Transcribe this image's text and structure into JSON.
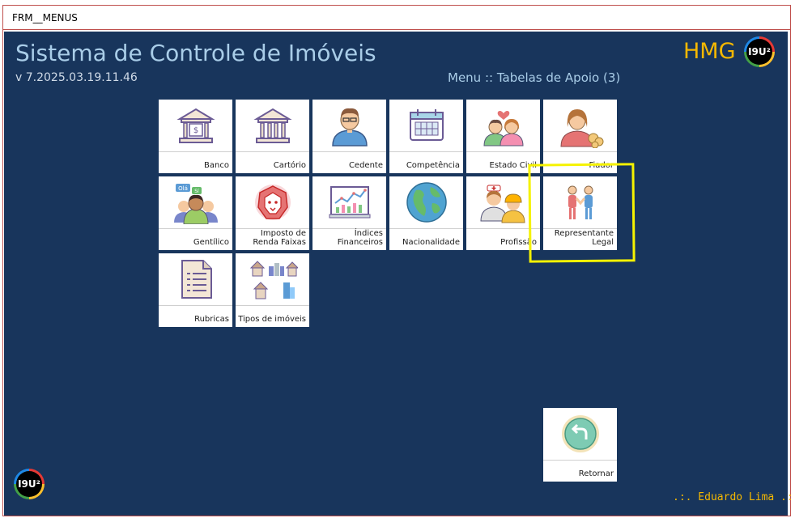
{
  "window": {
    "title": "FRM__MENUS"
  },
  "header": {
    "app_title": "Sistema de Controle de Imóveis",
    "version": "v 7.2025.03.19.11.46",
    "menu_caption": "Menu :: Tabelas de Apoio (3)",
    "brand": "HMG",
    "logo_text": "I9U²"
  },
  "tiles": [
    {
      "label": "Banco",
      "icon": "bank-icon"
    },
    {
      "label": "Cartório",
      "icon": "building-icon"
    },
    {
      "label": "Cedente",
      "icon": "person-icon"
    },
    {
      "label": "Competência",
      "icon": "calendar-icon"
    },
    {
      "label": "Estado Civil",
      "icon": "couple-icon"
    },
    {
      "label": "Fiador",
      "icon": "guarantor-icon"
    },
    {
      "label": "Gentílico",
      "icon": "people-chat-icon"
    },
    {
      "label": "Imposto de Renda Faixas",
      "icon": "lion-icon"
    },
    {
      "label": "Índices Financeiros",
      "icon": "financial-chart-icon"
    },
    {
      "label": "Nacionalidade",
      "icon": "globe-icon"
    },
    {
      "label": "Profissão",
      "icon": "workers-icon"
    },
    {
      "label": "Representante Legal",
      "icon": "handshake-icon"
    },
    {
      "label": "Rubricas",
      "icon": "document-icon"
    },
    {
      "label": "Tipos de imóveis",
      "icon": "buildings-icon"
    }
  ],
  "return_button": {
    "label": "Retornar",
    "icon": "return-arrow-icon"
  },
  "footer": {
    "user": ".:. Eduardo Lima .:."
  },
  "colors": {
    "background": "#18355c",
    "accent": "#f5b800",
    "title": "#a9cde8",
    "highlight": "#f5f200"
  }
}
